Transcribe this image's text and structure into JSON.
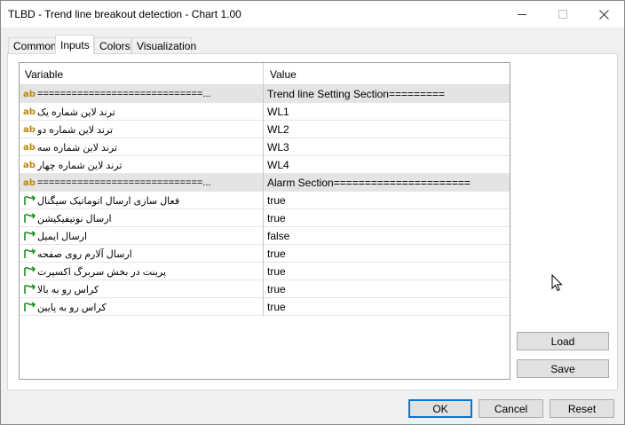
{
  "window": {
    "title": "TLBD - Trend line breakout detection - Chart 1.00"
  },
  "tabs": [
    {
      "label": "Common"
    },
    {
      "label": "Inputs"
    },
    {
      "label": "Colors"
    },
    {
      "label": "Visualization"
    }
  ],
  "grid": {
    "columns": {
      "variable": "Variable",
      "value": "Value"
    },
    "rows": [
      {
        "icon": "ab",
        "variable": "=============================...",
        "value": "Trend line  Setting Section========="
      },
      {
        "icon": "ab",
        "variable": "ترند لاین شماره یک",
        "value": "WL1"
      },
      {
        "icon": "ab",
        "variable": "ترند لاین شماره دو",
        "value": "WL2"
      },
      {
        "icon": "ab",
        "variable": "ترند لاین شماره سه",
        "value": "WL3"
      },
      {
        "icon": "ab",
        "variable": "ترند لاین شماره چهار",
        "value": "WL4"
      },
      {
        "icon": "ab",
        "variable": "=============================...",
        "value": "Alarm Section======================"
      },
      {
        "icon": "bool",
        "variable": "فعال سازی ارسال اتوماتیک سیگنال",
        "value": "true"
      },
      {
        "icon": "bool",
        "variable": "ارسال نوتیفیکیشن",
        "value": "true"
      },
      {
        "icon": "bool",
        "variable": "ارسال ایمیل",
        "value": "false"
      },
      {
        "icon": "bool",
        "variable": "ارسال آلارم روی صفحه",
        "value": "true"
      },
      {
        "icon": "bool",
        "variable": "پرینت در بخش سربرگ اکسپرت",
        "value": "true"
      },
      {
        "icon": "bool",
        "variable": "کراس رو به بالا",
        "value": "true"
      },
      {
        "icon": "bool",
        "variable": "کراس رو به پایین",
        "value": "true"
      }
    ]
  },
  "side_buttons": {
    "load": "Load",
    "save": "Save"
  },
  "footer_buttons": {
    "ok": "OK",
    "cancel": "Cancel",
    "reset": "Reset"
  },
  "colors": {
    "accent": "#0078d7",
    "ab_icon": "#b8860b",
    "bool_icon": "#1e8c1e"
  }
}
